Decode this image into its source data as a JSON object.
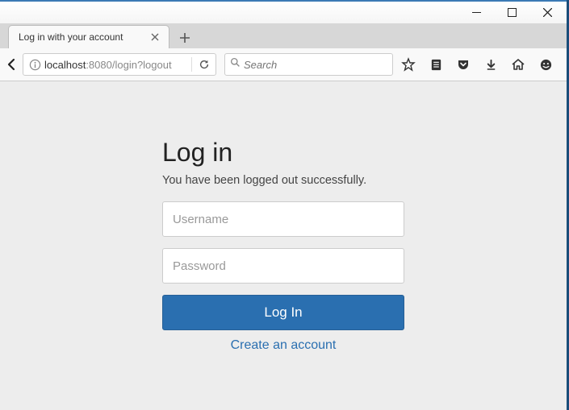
{
  "window": {
    "title": "Log in with your account"
  },
  "browser": {
    "url_host": "localhost",
    "url_port": ":8080",
    "url_path": "/login?logout",
    "search_placeholder": "Search"
  },
  "login": {
    "heading": "Log in",
    "message": "You have been logged out successfully.",
    "username_placeholder": "Username",
    "password_placeholder": "Password",
    "submit_label": "Log In",
    "create_link": "Create an account"
  }
}
